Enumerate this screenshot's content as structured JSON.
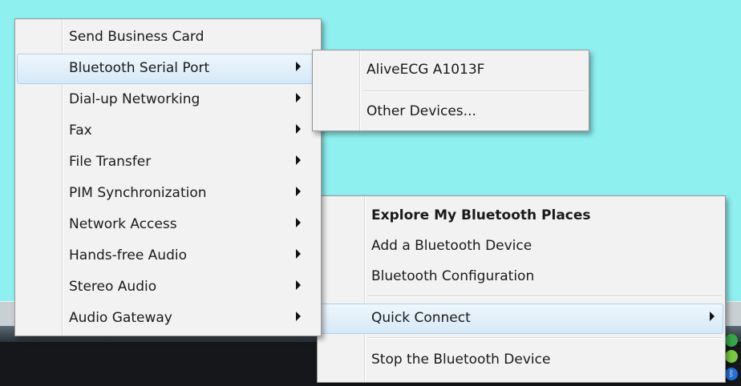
{
  "main_menu": {
    "items": [
      {
        "label": "Send Business Card",
        "submenu": false
      },
      {
        "label": "Bluetooth Serial Port",
        "submenu": true
      },
      {
        "label": "Dial-up Networking",
        "submenu": true
      },
      {
        "label": "Fax",
        "submenu": true
      },
      {
        "label": "File Transfer",
        "submenu": true
      },
      {
        "label": "PIM Synchronization",
        "submenu": true
      },
      {
        "label": "Network Access",
        "submenu": true
      },
      {
        "label": "Hands-free Audio",
        "submenu": true
      },
      {
        "label": "Stereo Audio",
        "submenu": true
      },
      {
        "label": "Audio Gateway",
        "submenu": true
      }
    ]
  },
  "serial_port_submenu": {
    "items": [
      {
        "label": "AliveECG A1013F"
      },
      {
        "label": "Other Devices..."
      }
    ]
  },
  "bluetooth_menu": {
    "items": [
      {
        "label": "Explore My Bluetooth Places",
        "bold": true
      },
      {
        "label": "Add a Bluetooth Device"
      },
      {
        "label": "Bluetooth Configuration"
      },
      {
        "label": "Quick Connect",
        "submenu": true
      },
      {
        "label": "Stop the Bluetooth Device"
      }
    ]
  },
  "colors": {
    "desktop": "#8ff0f0",
    "menu_bg": "#f2f2f2",
    "highlight_border": "#a9d2f0",
    "taskbar": "#15171a"
  },
  "tray_icons": [
    "network-icon",
    "shield-icon",
    "bluetooth-icon"
  ]
}
